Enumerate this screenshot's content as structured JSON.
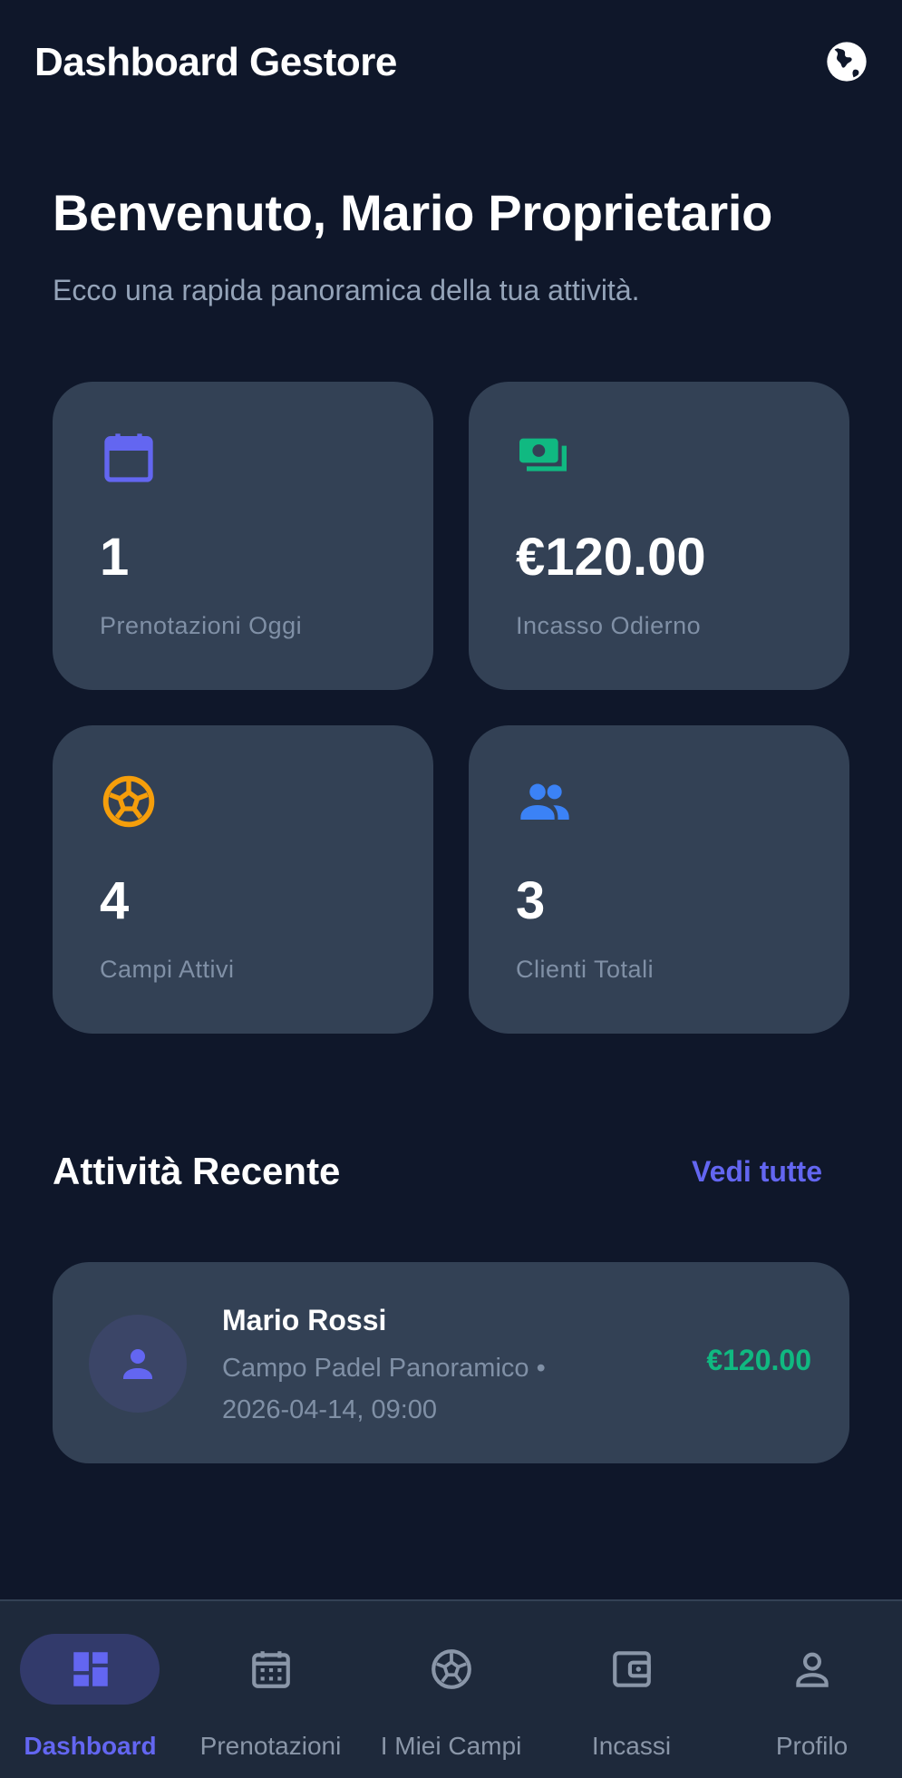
{
  "appbar": {
    "title": "Dashboard Gestore",
    "language_icon": "globe-icon"
  },
  "welcome": {
    "title": "Benvenuto, Mario Proprietario",
    "subtitle": "Ecco una rapida panoramica della tua attività."
  },
  "stats": [
    {
      "icon": "calendar-icon",
      "value": "1",
      "label": "Prenotazioni Oggi",
      "color": "#6366f1"
    },
    {
      "icon": "money-icon",
      "value": "€120.00",
      "label": "Incasso Odierno",
      "color": "#10b981"
    },
    {
      "icon": "soccer-ball-icon",
      "value": "4",
      "label": "Campi Attivi",
      "color": "#f59e0b"
    },
    {
      "icon": "group-icon",
      "value": "3",
      "label": "Clienti Totali",
      "color": "#3b82f6"
    }
  ],
  "recent": {
    "title": "Attività Recente",
    "see_all": "Vedi tutte",
    "items": [
      {
        "name": "Mario Rossi",
        "detail": "Campo Padel Panoramico • 2026-04-14, 09:00",
        "amount": "€120.00"
      }
    ]
  },
  "nav": {
    "items": [
      {
        "label": "Dashboard",
        "icon": "dashboard-icon",
        "active": true
      },
      {
        "label": "Prenotazioni",
        "icon": "calendar-icon",
        "active": false
      },
      {
        "label": "I Miei Campi",
        "icon": "soccer-ball-icon",
        "active": false
      },
      {
        "label": "Incassi",
        "icon": "wallet-icon",
        "active": false
      },
      {
        "label": "Profilo",
        "icon": "person-icon",
        "active": false
      }
    ]
  },
  "colors": {
    "background": "#0f172a",
    "card": "#334155",
    "accent": "#6366f1",
    "success": "#10b981",
    "warning": "#f59e0b",
    "info": "#3b82f6"
  }
}
